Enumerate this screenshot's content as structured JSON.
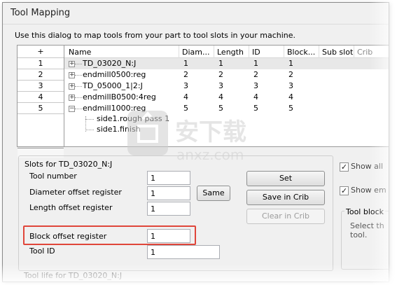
{
  "window": {
    "title": "Tool Mapping"
  },
  "intro": "Use this dialog to map tools from your part to tool slots in your machine.",
  "row_header": {
    "add_label": "+",
    "rows": [
      "1",
      "2",
      "3",
      "4",
      "5"
    ]
  },
  "grid": {
    "columns": [
      "Name",
      "Diam...",
      "Length",
      "ID",
      "Block...",
      "Sub slot",
      "Crib"
    ],
    "rows": [
      {
        "name": "TD_03020_N:J",
        "diam": "1",
        "length": "1",
        "id": "1",
        "block": "1",
        "expander": "+"
      },
      {
        "name": "endmill0500:reg",
        "diam": "2",
        "length": "2",
        "id": "2",
        "block": "2",
        "expander": "+"
      },
      {
        "name": "TD_05000_1|2:J",
        "diam": "3",
        "length": "3",
        "id": "3",
        "block": "3",
        "expander": "+"
      },
      {
        "name": "endmillB0500:4reg",
        "diam": "4",
        "length": "4",
        "id": "4",
        "block": "4",
        "expander": "+"
      },
      {
        "name": "endmill1000:reg",
        "diam": "5",
        "length": "5",
        "id": "5",
        "block": "5",
        "expander": "−"
      }
    ],
    "children": [
      "side1.rough pass 1",
      "side1.finish"
    ]
  },
  "slots": {
    "title": "Slots for TD_03020_N:J",
    "tool_number": {
      "label": "Tool number",
      "value": "1"
    },
    "diameter_offset": {
      "label": "Diameter offset register",
      "value": "1"
    },
    "length_offset": {
      "label": "Length offset register",
      "value": "1"
    },
    "block_offset": {
      "label": "Block offset register",
      "value": "1"
    },
    "tool_id": {
      "label": "Tool ID",
      "value": "1"
    },
    "same_button": "Same",
    "set_button": "Set",
    "save_crib_button": "Save in Crib",
    "clear_crib_button": "Clear in Crib"
  },
  "right_panel": {
    "show_all": "Show all",
    "show_em": "Show em",
    "tool_block_title": "Tool block",
    "tool_block_text_1": "Select th",
    "tool_block_text_2": "tool."
  },
  "bottom": {
    "tool_life_label": "Tool life for TD_03020_N:J"
  },
  "watermark": {
    "text_cn": "安下载",
    "text_en": "anxz.com"
  },
  "colors": {
    "highlight": "#e0463a",
    "selected_row": "#e8e8e8"
  }
}
